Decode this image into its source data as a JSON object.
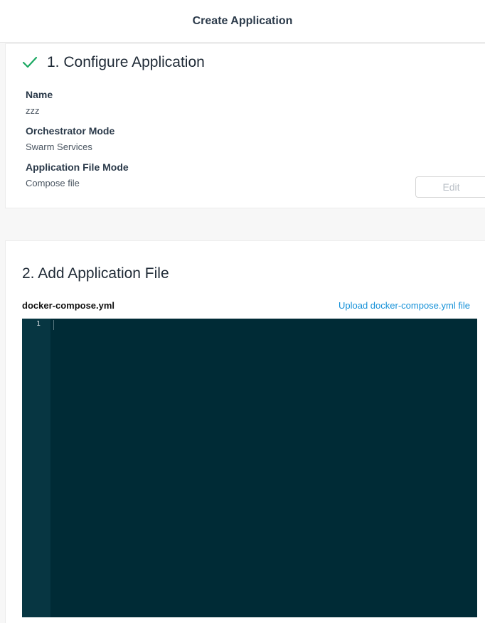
{
  "header": {
    "title": "Create Application"
  },
  "step1": {
    "title": "1. Configure Application",
    "fields": [
      {
        "label": "Name",
        "value": "zzz"
      },
      {
        "label": "Orchestrator Mode",
        "value": "Swarm Services"
      },
      {
        "label": "Application File Mode",
        "value": "Compose file"
      }
    ],
    "edit_label": "Edit",
    "check_color": "#1aa861"
  },
  "step2": {
    "title": "2. Add Application File",
    "file_label": "docker-compose.yml",
    "upload_label": "Upload docker-compose.yml file",
    "editor": {
      "line_numbers": [
        "1"
      ],
      "content": ""
    }
  }
}
